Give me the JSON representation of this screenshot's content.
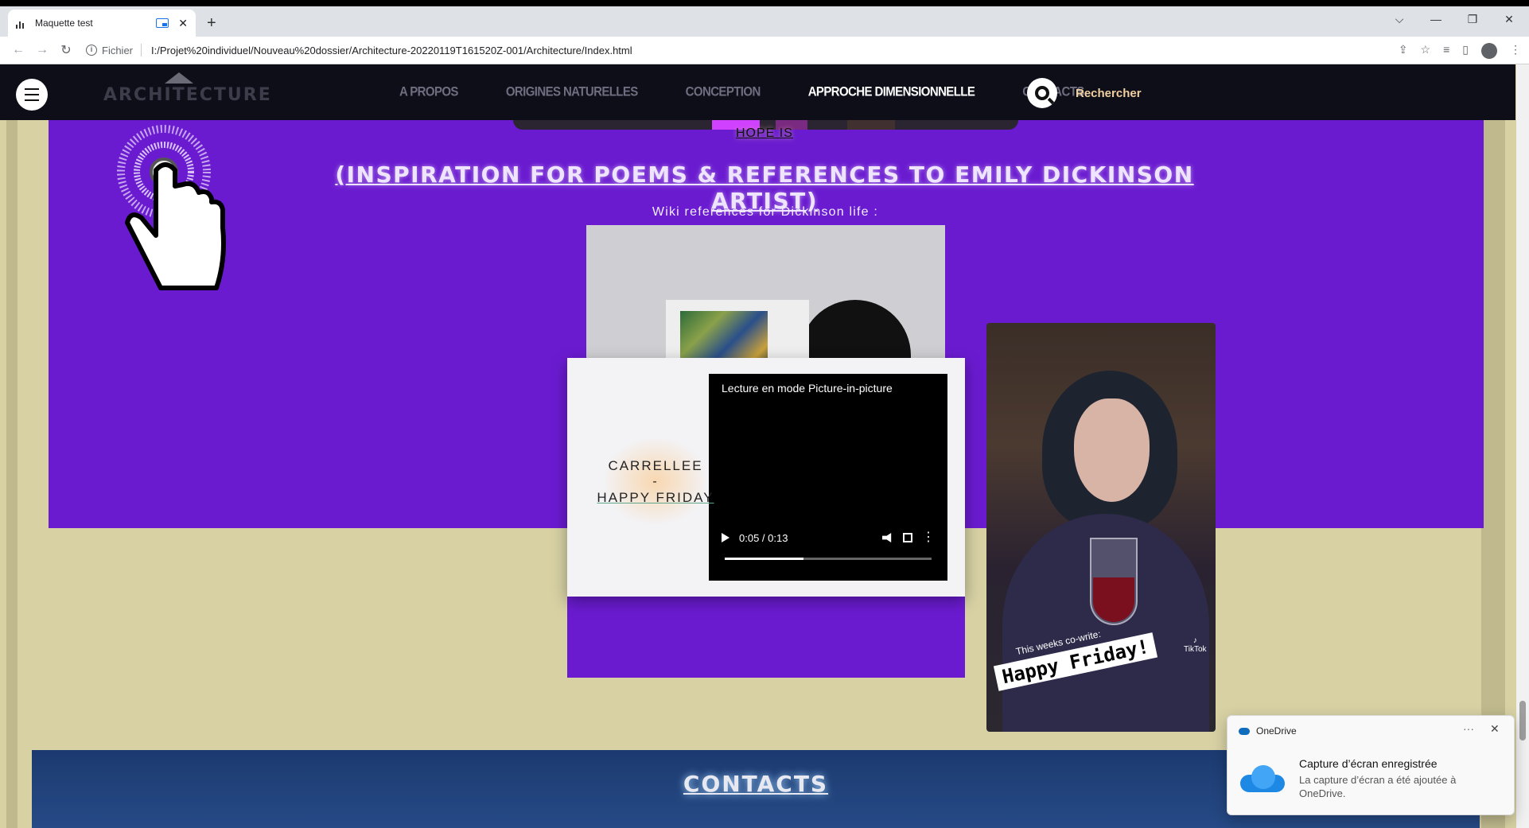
{
  "browser": {
    "tab_title": "Maquette test",
    "new_tab": "+",
    "url_scheme": "Fichier",
    "url": "I:/Projet%20individuel/Nouveau%20dossier/Architecture-20220119T161520Z-001/Architecture/Index.html",
    "window_controls": [
      "⌵",
      "—",
      "❐",
      "✕"
    ]
  },
  "site": {
    "logo": "ARCHITECTURE",
    "menu": [
      "A PROPOS",
      "ORIGINES NATURELLES",
      "CONCEPTION",
      "APPROCHE DIMENSIONNELLE",
      "CONTACTS"
    ],
    "active_menu": "APPROCHE DIMENSIONNELLE",
    "search_label": "Rechercher"
  },
  "content": {
    "hope_is": "HOPE IS",
    "headline": "(INSPIRATION FOR POEMS & REFERENCES TO EMILY DICKINSON ARTIST)",
    "wiki": "Wiki references for Dickinson life :",
    "card_artist": "CARRELLEE",
    "card_dash": "-",
    "card_song": "HAPPY FRIDAY",
    "pip_message": "Lecture en mode Picture-in-picture",
    "player_time": "0:05 / 0:13",
    "player_progress": 0.38,
    "photo_caption": "This weeks co-write:",
    "photo_stamp": "Happy Friday!",
    "photo_badge": "TikTok",
    "contacts_title": "CONTACTS"
  },
  "toast": {
    "app": "OneDrive",
    "more": "···",
    "close": "✕",
    "title": "Capture d’écran enregistrée",
    "body": "La capture d’écran a été ajoutée à OneDrive."
  },
  "colors": {
    "purple_band": "#6a1bd0",
    "page_bg": "#d7d1a4",
    "nav_bg": "#0e0e18",
    "search_label": "#f0cfa0"
  }
}
